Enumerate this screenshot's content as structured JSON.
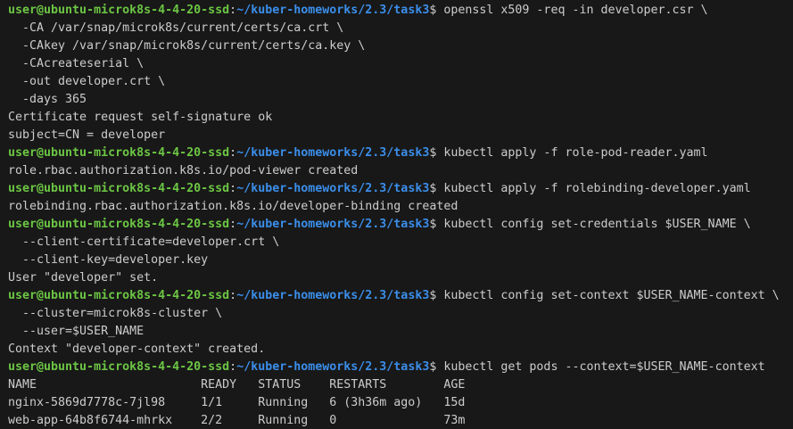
{
  "colors": {
    "background": "#181818",
    "text": "#cccccc",
    "prompt_user": "#6cc644",
    "prompt_path": "#3b8eea"
  },
  "prompt": {
    "user_host": "user@ubuntu-microk8s-4-4-20-ssd",
    "colon": ":",
    "path": "~/kuber-homeworks/2.3/task3",
    "dollar": "$ "
  },
  "lines": [
    {
      "type": "prompt",
      "text": "openssl x509 -req -in developer.csr \\"
    },
    {
      "type": "output",
      "text": "  -CA /var/snap/microk8s/current/certs/ca.crt \\"
    },
    {
      "type": "output",
      "text": "  -CAkey /var/snap/microk8s/current/certs/ca.key \\"
    },
    {
      "type": "output",
      "text": "  -CAcreateserial \\"
    },
    {
      "type": "output",
      "text": "  -out developer.crt \\"
    },
    {
      "type": "output",
      "text": "  -days 365"
    },
    {
      "type": "output",
      "text": "Certificate request self-signature ok"
    },
    {
      "type": "output",
      "text": "subject=CN = developer"
    },
    {
      "type": "prompt",
      "text": "kubectl apply -f role-pod-reader.yaml"
    },
    {
      "type": "output",
      "text": "role.rbac.authorization.k8s.io/pod-viewer created"
    },
    {
      "type": "prompt",
      "text": "kubectl apply -f rolebinding-developer.yaml"
    },
    {
      "type": "output",
      "text": "rolebinding.rbac.authorization.k8s.io/developer-binding created"
    },
    {
      "type": "prompt",
      "text": "kubectl config set-credentials $USER_NAME \\"
    },
    {
      "type": "output",
      "text": "  --client-certificate=developer.crt \\"
    },
    {
      "type": "output",
      "text": "  --client-key=developer.key"
    },
    {
      "type": "output",
      "text": "User \"developer\" set."
    },
    {
      "type": "prompt",
      "text": "kubectl config set-context $USER_NAME-context \\"
    },
    {
      "type": "output",
      "text": "  --cluster=microk8s-cluster \\"
    },
    {
      "type": "output",
      "text": "  --user=$USER_NAME"
    },
    {
      "type": "output",
      "text": "Context \"developer-context\" created."
    },
    {
      "type": "prompt",
      "text": "kubectl get pods --context=$USER_NAME-context"
    },
    {
      "type": "output",
      "text": "NAME                       READY   STATUS    RESTARTS        AGE"
    },
    {
      "type": "output",
      "text": "nginx-5869d7778c-7jl98     1/1     Running   6 (3h36m ago)   15d"
    },
    {
      "type": "output",
      "text": "web-app-64b8f6744-mhrkx    2/2     Running   0               73m"
    }
  ]
}
